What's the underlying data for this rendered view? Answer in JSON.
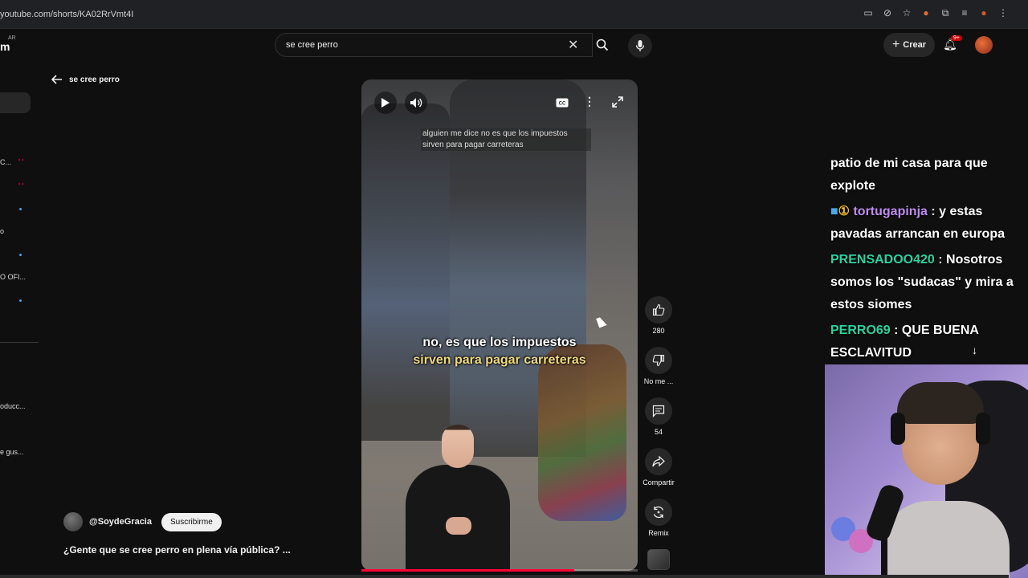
{
  "browser": {
    "url": "youtube.com/shorts/KA02RrVmt4I"
  },
  "header": {
    "logo_fragment": "m",
    "country": "AR",
    "search_value": "se cree perro",
    "create_label": "Crear",
    "notifications_badge": "9+"
  },
  "back_label": "se cree perro",
  "sidebar": {
    "items": [
      "C...",
      "o",
      "O OFI...",
      "oducc...",
      "e gus..."
    ]
  },
  "player": {
    "caption_top": "alguien me dice no es que los impuestos sirven para pagar carreteras",
    "subtitle_line1": "no, es que los impuestos",
    "subtitle_line2": "sirven para pagar carreteras",
    "progress": 0.77
  },
  "actions": {
    "like_count": "280",
    "dislike_label": "No me ...",
    "comments_count": "54",
    "share_label": "Compartir",
    "remix_label": "Remix"
  },
  "channel": {
    "name": "@SoydeGracia",
    "subscribe_label": "Suscribirme"
  },
  "video_title": "¿Gente que se cree perro en plena vía pública? ...",
  "chat": {
    "msg1_text": "patio de mi casa para que explote",
    "msg2_user": "tortugapinja",
    "msg2_text": ": y estas pavadas arrancan en europa",
    "msg3_user": "PRENSADOO420",
    "msg3_text": ": Nosotros somos los \"sudacas\" y mira a estos siomes",
    "msg4_user": "PERRO69",
    "msg4_text": ": QUE BUENA ESCLAVITUD"
  },
  "colors": {
    "accent_red": "#ff0033",
    "chat_purple": "#c08bf0",
    "chat_green": "#27d4a0"
  }
}
